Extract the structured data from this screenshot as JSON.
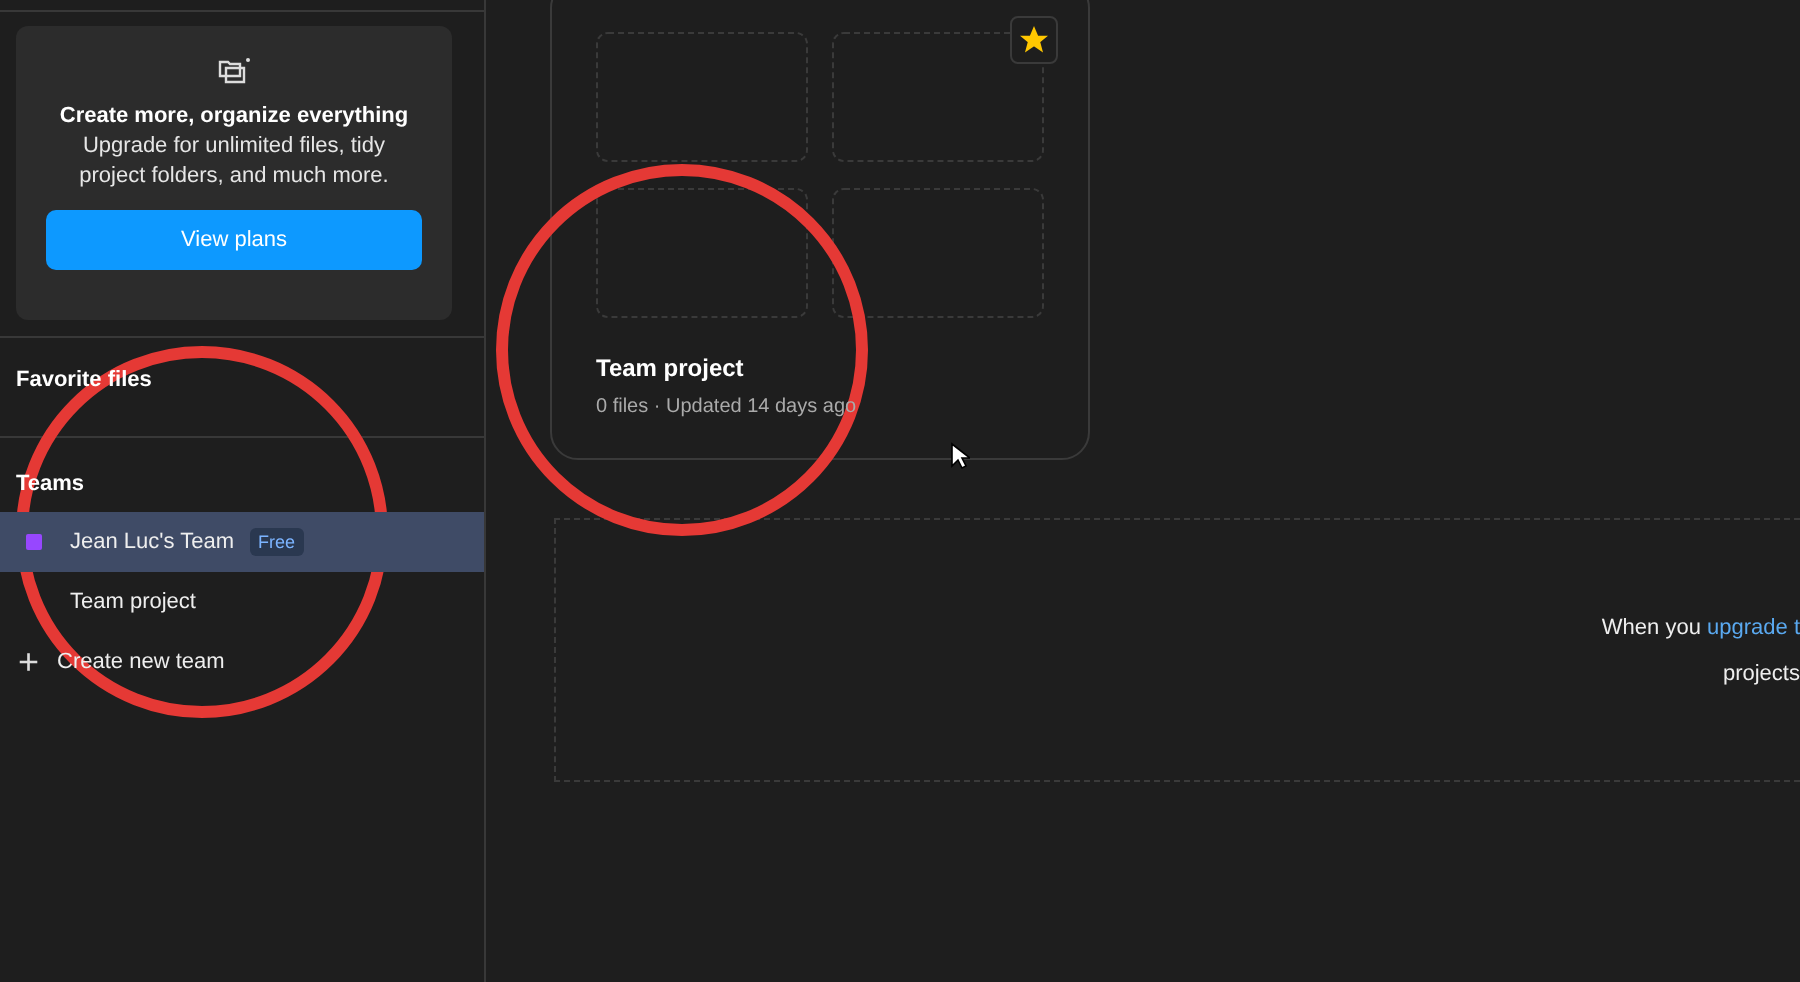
{
  "sidebar": {
    "upgrade_card": {
      "title": "Create more, organize everything",
      "text": "Upgrade for unlimited files, tidy project folders, and much more.",
      "button": "View plans"
    },
    "favorites_heading": "Favorite files",
    "teams_heading": "Teams",
    "teams": [
      {
        "name": "Jean Luc's Team",
        "badge": "Free",
        "color": "#9747ff",
        "selected": true
      },
      {
        "name": "Team project",
        "selected": false
      }
    ],
    "create_team": {
      "icon": "+",
      "label": "Create new team"
    }
  },
  "project_card": {
    "title": "Team project",
    "meta": "0 files · Updated 14 days ago",
    "starred": true
  },
  "upgrade_notice": {
    "line_1": "When you",
    "link": "upgrade t",
    "line_2": "projects"
  }
}
